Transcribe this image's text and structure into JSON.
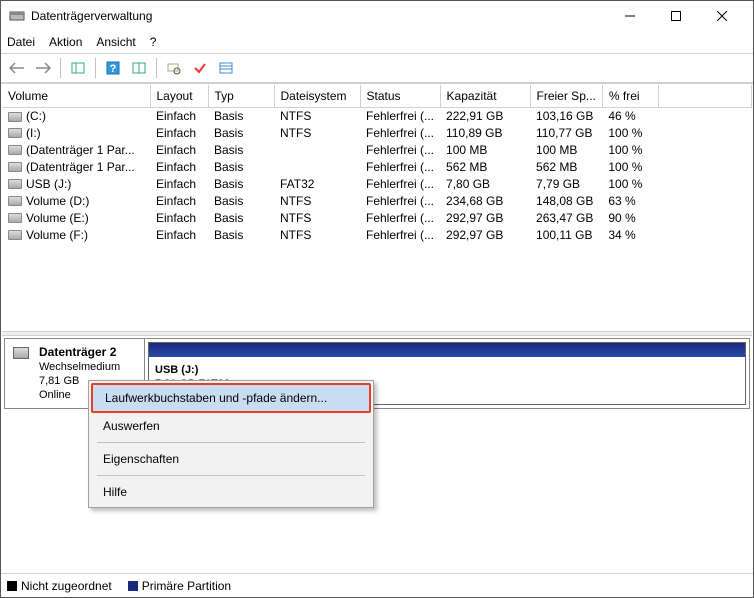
{
  "window": {
    "title": "Datenträgerverwaltung"
  },
  "menu": {
    "file": "Datei",
    "action": "Aktion",
    "view": "Ansicht",
    "help": "?"
  },
  "columns": {
    "c0": "Volume",
    "c1": "Layout",
    "c2": "Typ",
    "c3": "Dateisystem",
    "c4": "Status",
    "c5": "Kapazität",
    "c6": "Freier Sp...",
    "c7": "% frei"
  },
  "rows": [
    {
      "vol": "(C:)",
      "layout": "Einfach",
      "typ": "Basis",
      "fs": "NTFS",
      "status": "Fehlerfrei (...",
      "cap": "222,91 GB",
      "free": "103,16 GB",
      "pct": "46 %"
    },
    {
      "vol": "(I:)",
      "layout": "Einfach",
      "typ": "Basis",
      "fs": "NTFS",
      "status": "Fehlerfrei (...",
      "cap": "110,89 GB",
      "free": "110,77 GB",
      "pct": "100 %"
    },
    {
      "vol": "(Datenträger 1 Par...",
      "layout": "Einfach",
      "typ": "Basis",
      "fs": "",
      "status": "Fehlerfrei (...",
      "cap": "100 MB",
      "free": "100 MB",
      "pct": "100 %"
    },
    {
      "vol": "(Datenträger 1 Par...",
      "layout": "Einfach",
      "typ": "Basis",
      "fs": "",
      "status": "Fehlerfrei (...",
      "cap": "562 MB",
      "free": "562 MB",
      "pct": "100 %"
    },
    {
      "vol": "USB (J:)",
      "layout": "Einfach",
      "typ": "Basis",
      "fs": "FAT32",
      "status": "Fehlerfrei (...",
      "cap": "7,80 GB",
      "free": "7,79 GB",
      "pct": "100 %"
    },
    {
      "vol": "Volume (D:)",
      "layout": "Einfach",
      "typ": "Basis",
      "fs": "NTFS",
      "status": "Fehlerfrei (...",
      "cap": "234,68 GB",
      "free": "148,08 GB",
      "pct": "63 %"
    },
    {
      "vol": "Volume (E:)",
      "layout": "Einfach",
      "typ": "Basis",
      "fs": "NTFS",
      "status": "Fehlerfrei (...",
      "cap": "292,97 GB",
      "free": "263,47 GB",
      "pct": "90 %"
    },
    {
      "vol": "Volume (F:)",
      "layout": "Einfach",
      "typ": "Basis",
      "fs": "NTFS",
      "status": "Fehlerfrei (...",
      "cap": "292,97 GB",
      "free": "100,11 GB",
      "pct": "34 %"
    }
  ],
  "disk": {
    "name": "Datenträger 2",
    "type": "Wechselmedium",
    "size": "7,81 GB",
    "status": "Online",
    "vol_name": "USB  (J:)",
    "vol_sub": "7,81 GB FAT32"
  },
  "ctx": {
    "change": "Laufwerkbuchstaben und -pfade ändern...",
    "eject": "Auswerfen",
    "props": "Eigenschaften",
    "help": "Hilfe"
  },
  "legend": {
    "unalloc": "Nicht zugeordnet",
    "primary": "Primäre Partition"
  }
}
